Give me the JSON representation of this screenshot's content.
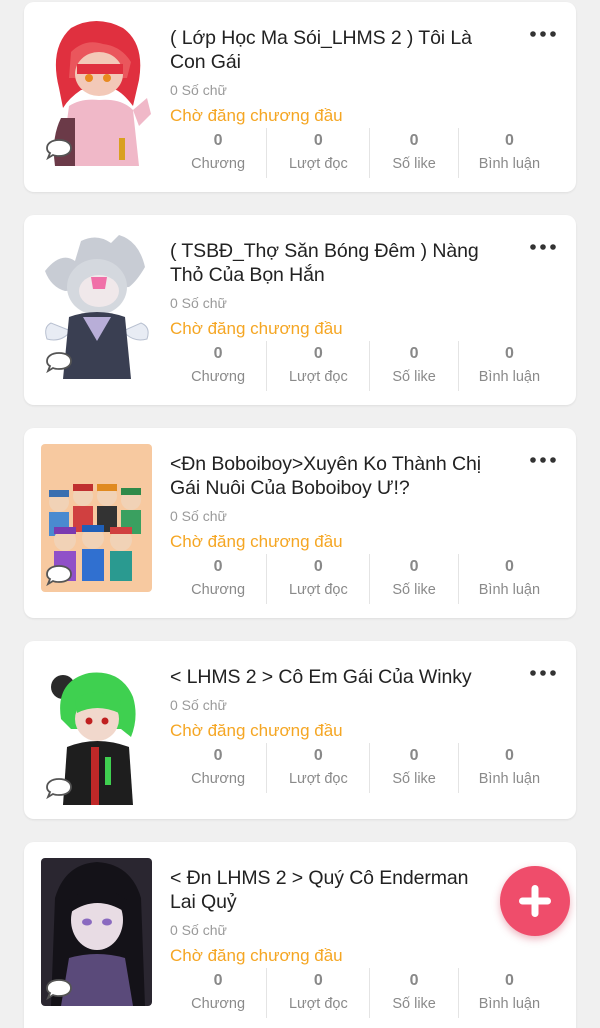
{
  "colors": {
    "accent": "#f5a623",
    "fab": "#ef4d6b",
    "card": "#ffffff",
    "background": "#f0f0f0"
  },
  "stat_labels": {
    "chapters": "Chương",
    "reads": "Lượt đọc",
    "likes": "Số like",
    "comments": "Bình luận"
  },
  "stories": [
    {
      "title": "( Lớp Học Ma Sói_LHMS 2 ) Tôi Là Con Gái",
      "word_count": "0 Số chữ",
      "status": "Chờ đăng chương đầu",
      "chapters": "0",
      "reads": "0",
      "likes": "0",
      "comments": "0",
      "cover_icon": "red-hair-character-cover"
    },
    {
      "title": "( TSBĐ_Thợ Săn Bóng Đêm ) Nàng Thỏ Của Bọn Hắn",
      "word_count": "0 Số chữ",
      "status": "Chờ đăng chương đầu",
      "chapters": "0",
      "reads": "0",
      "likes": "0",
      "comments": "0",
      "cover_icon": "grey-bunny-character-cover"
    },
    {
      "title": "<Đn Boboiboy>Xuyên Ko Thành Chị Gái Nuôi Của Boboiboy Ư!?",
      "word_count": "0 Số chữ",
      "status": "Chờ đăng chương đầu",
      "chapters": "0",
      "reads": "0",
      "likes": "0",
      "comments": "0",
      "cover_icon": "group-characters-cover"
    },
    {
      "title": "< LHMS 2 > Cô Em Gái Của Winky",
      "word_count": "0 Số chữ",
      "status": "Chờ đăng chương đầu",
      "chapters": "0",
      "reads": "0",
      "likes": "0",
      "comments": "0",
      "cover_icon": "green-hair-character-cover"
    },
    {
      "title": "< Đn LHMS 2 > Quý Cô Enderman Lai Quỷ",
      "word_count": "0 Số chữ",
      "status": "Chờ đăng chương đầu",
      "chapters": "0",
      "reads": "0",
      "likes": "0",
      "comments": "0",
      "cover_icon": "dark-hair-girl-cover"
    }
  ],
  "fab_icon": "plus-icon"
}
